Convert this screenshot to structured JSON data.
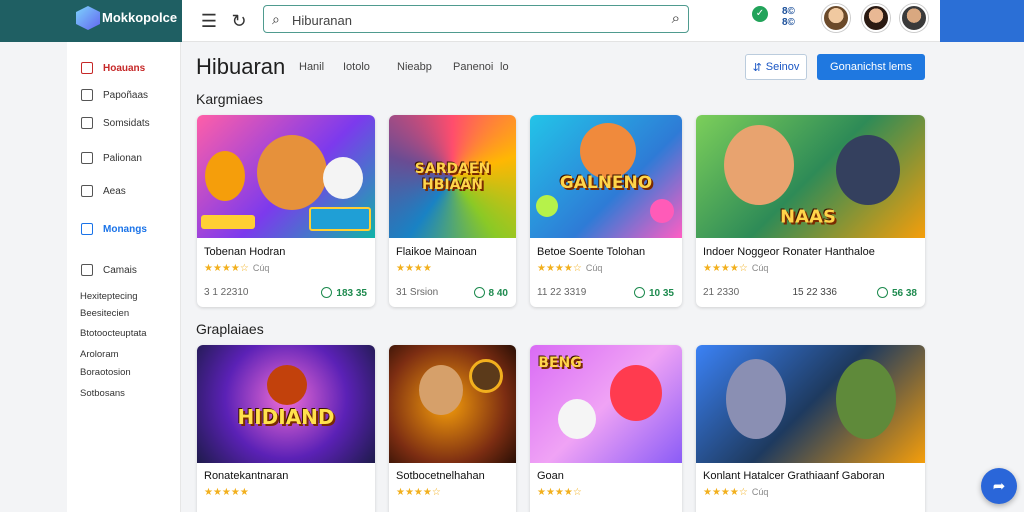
{
  "app": {
    "name": "Mokkopolce"
  },
  "search": {
    "value": "Hiburanan",
    "placeholder": "Hiburanan"
  },
  "header_badge": "8©\n8©",
  "sidebar": {
    "items": [
      {
        "label": "Hoauans",
        "icon": "grid-icon"
      },
      {
        "label": "Papoñaas",
        "icon": "bag-icon"
      },
      {
        "label": "Somsidats",
        "icon": "box-icon"
      },
      {
        "label": "Palionan",
        "icon": "user-icon"
      },
      {
        "label": "Aeas",
        "icon": "chart-icon"
      },
      {
        "label": "Monangs",
        "icon": "check-icon"
      },
      {
        "label": "Camais",
        "icon": "cart-icon"
      }
    ],
    "subs": [
      "Hexiteptecing",
      "Beesitecien",
      "Btotoocteuptata",
      "Aroloram",
      "Boraotosion",
      "Sotbosans"
    ]
  },
  "main": {
    "title": "Hibuaran",
    "tabs": [
      "Hanil",
      "Iotolo",
      "Nieabp",
      "Panenoi",
      "lo"
    ],
    "secondary_button": "Seinov",
    "primary_button": "Gonanichst lems"
  },
  "sections": [
    {
      "title": "Kargmiaes",
      "cards": [
        {
          "art_text": "",
          "title": "Tobenan Hodran",
          "rating_extra": "Cúq",
          "meta_left": "3 1 22310",
          "meta_right": "183 35"
        },
        {
          "art_text": "SARDAEN HBIAAN",
          "title": "Flaikoe Mainoan",
          "rating_extra": "",
          "meta_left": "31 Srsion",
          "meta_right": "8 40"
        },
        {
          "art_text": "GALNENO",
          "title": "Betoe Soente Tolohan",
          "rating_extra": "Cúq",
          "meta_left": "11 22 3319",
          "meta_right": "10 35"
        },
        {
          "art_text": "NAAS",
          "title": "Indoer Noggeor Ronater Hanthaloe",
          "rating_extra": "Cúq",
          "meta_left": "21 2330",
          "meta_right": "15 22 336"
        }
      ]
    },
    {
      "title": "Graplaiaes",
      "cards": [
        {
          "art_text": "HIDIAND",
          "title": "Ronatekantnaran",
          "rating_extra": "",
          "meta_left": "",
          "meta_right": ""
        },
        {
          "art_text": "",
          "title": "Sotbocetnelhahan",
          "rating_extra": "",
          "meta_left": "",
          "meta_right": ""
        },
        {
          "art_text": "BENG",
          "title": "Goan",
          "rating_extra": "",
          "meta_left": "",
          "meta_right": ""
        },
        {
          "art_text": "",
          "title": "Konlant Hatalcer Grathiaanf Gaboran",
          "rating_extra": "Cúq",
          "meta_left": "",
          "meta_right": ""
        }
      ]
    }
  ],
  "extra_meta": {
    "card2_right": "8 40",
    "row1_card4_right": "56 38"
  },
  "colors": {
    "brand": "#1f5f63",
    "primary": "#1f78e0",
    "rating": "#f2b01e",
    "active": "#c62828"
  }
}
